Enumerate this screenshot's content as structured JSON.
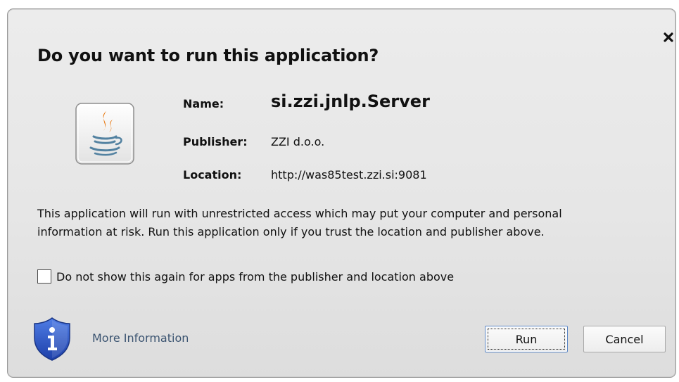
{
  "dialog": {
    "title": "Do you want to run this application?",
    "close_icon": "close-icon",
    "app_icon": "java-icon",
    "fields": {
      "name_label": "Name:",
      "name_value": "si.zzi.jnlp.Server",
      "publisher_label": "Publisher:",
      "publisher_value": "ZZI d.o.o.",
      "location_label": "Location:",
      "location_value": "http://was85test.zzi.si:9081"
    },
    "warning_line1": "This application will run with unrestricted access which may put your computer and personal",
    "warning_line2": "information at risk. Run this application only if you trust the location and publisher above.",
    "checkbox": {
      "label": "Do not show this again for apps from the publisher and location above",
      "checked": false
    },
    "info_icon": "shield-info-icon",
    "more_info_link": "More Information",
    "run_button": "Run",
    "cancel_button": "Cancel"
  },
  "colors": {
    "dialog_bg": "#e6e6e6",
    "link_text": "#3a5370",
    "shield_blue": "#2f56c8",
    "java_orange": "#e76f00",
    "java_blue": "#5382a1"
  }
}
